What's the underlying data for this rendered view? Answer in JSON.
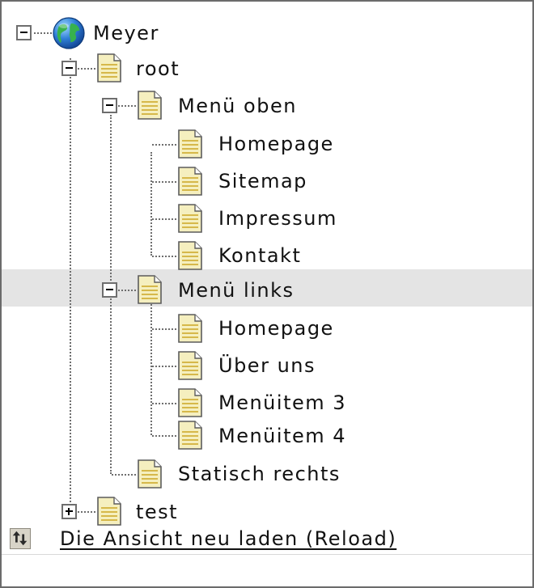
{
  "tree": {
    "root": {
      "label": "Meyer",
      "icon": "globe-icon",
      "expanded": true
    },
    "nodes": [
      {
        "label": "root",
        "icon": "document-icon",
        "expanded": true
      },
      {
        "label": "Menü oben",
        "icon": "document-icon",
        "expanded": true
      },
      {
        "label": "Homepage",
        "icon": "document-icon"
      },
      {
        "label": "Sitemap",
        "icon": "document-icon"
      },
      {
        "label": "Impressum",
        "icon": "document-icon"
      },
      {
        "label": "Kontakt",
        "icon": "document-icon"
      },
      {
        "label": "Menü links",
        "icon": "document-icon",
        "expanded": true,
        "highlighted": true
      },
      {
        "label": "Homepage",
        "icon": "document-icon"
      },
      {
        "label": "Über uns",
        "icon": "document-icon"
      },
      {
        "label": "Menüitem 3",
        "icon": "document-icon"
      },
      {
        "label": "Menüitem 4",
        "icon": "document-icon"
      },
      {
        "label": "Statisch rechts",
        "icon": "document-icon"
      },
      {
        "label": "test",
        "icon": "document-icon",
        "expanded": false
      }
    ]
  },
  "footer": {
    "reload_label": "Die Ansicht neu laden (Reload)",
    "reload_icon": "reload-icon"
  },
  "colors": {
    "highlight_row": "#e4e4e4",
    "document_fill": "#f5efbf",
    "document_lines": "#d6b84a",
    "frame_border": "#6b6b6b"
  }
}
